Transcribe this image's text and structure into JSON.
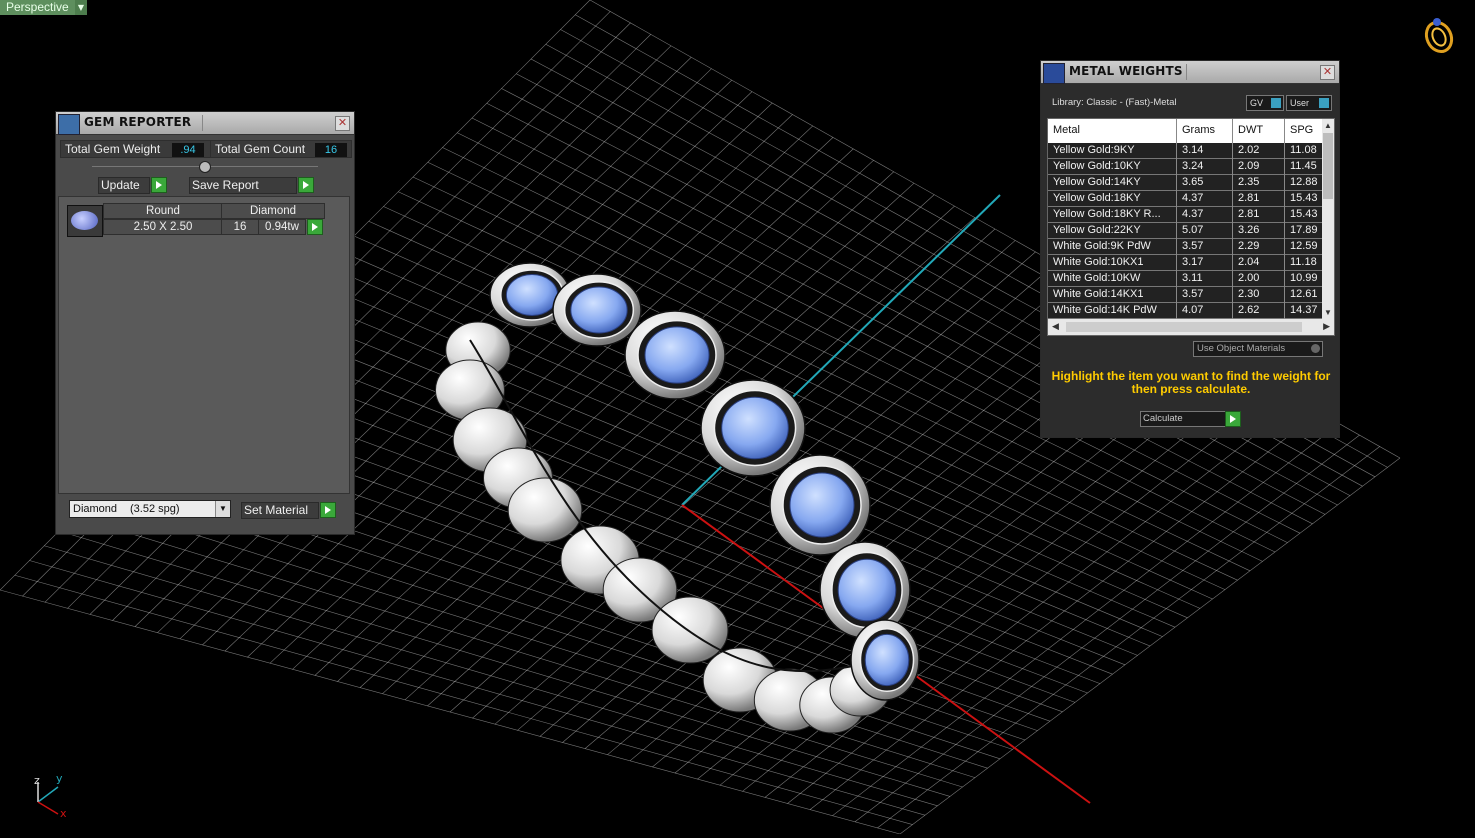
{
  "viewport": {
    "view_label": "Perspective",
    "axis_labels": {
      "x": "x",
      "y": "y",
      "z": "z"
    },
    "colors": {
      "grid": "#d8d8d8",
      "x_axis": "#cc1111",
      "y_axis": "#22a8b8",
      "background": "#000000"
    }
  },
  "gem_reporter": {
    "title": "GEM REPORTER",
    "total_weight_label": "Total Gem Weight",
    "total_weight_value": ".94",
    "total_count_label": "Total Gem Count",
    "total_count_value": "16",
    "update_label": "Update",
    "save_report_label": "Save Report",
    "gem_row": {
      "shape": "Round",
      "material": "Diamond",
      "size": "2.50 X 2.50",
      "count": "16",
      "weight": "0.94tw"
    },
    "material_select": {
      "name": "Diamond",
      "spg": "(3.52 spg)"
    },
    "set_material_label": "Set Material"
  },
  "metal_weights": {
    "title": "METAL WEIGHTS",
    "library_label": "Library: Classic - (Fast)-Metal",
    "gv_label": "GV",
    "user_label": "User",
    "columns": [
      "Metal",
      "Grams",
      "DWT",
      "SPG"
    ],
    "rows": [
      [
        "Yellow Gold:9KY",
        "3.14",
        "2.02",
        "11.08"
      ],
      [
        "Yellow Gold:10KY",
        "3.24",
        "2.09",
        "11.45"
      ],
      [
        "Yellow Gold:14KY",
        "3.65",
        "2.35",
        "12.88"
      ],
      [
        "Yellow Gold:18KY",
        "4.37",
        "2.81",
        "15.43"
      ],
      [
        "Yellow Gold:18KY R...",
        "4.37",
        "2.81",
        "15.43"
      ],
      [
        "Yellow Gold:22KY",
        "5.07",
        "3.26",
        "17.89"
      ],
      [
        "White Gold:9K PdW",
        "3.57",
        "2.29",
        "12.59"
      ],
      [
        "White Gold:10KX1",
        "3.17",
        "2.04",
        "11.18"
      ],
      [
        "White Gold:10KW",
        "3.11",
        "2.00",
        "10.99"
      ],
      [
        "White Gold:14KX1",
        "3.57",
        "2.30",
        "12.61"
      ],
      [
        "White Gold:14K PdW",
        "4.07",
        "2.62",
        "14.37"
      ]
    ],
    "use_object_materials_label": "Use Object Materials",
    "hint": "Highlight the item you want to find the weight for then press calculate.",
    "calculate_label": "Calculate"
  }
}
